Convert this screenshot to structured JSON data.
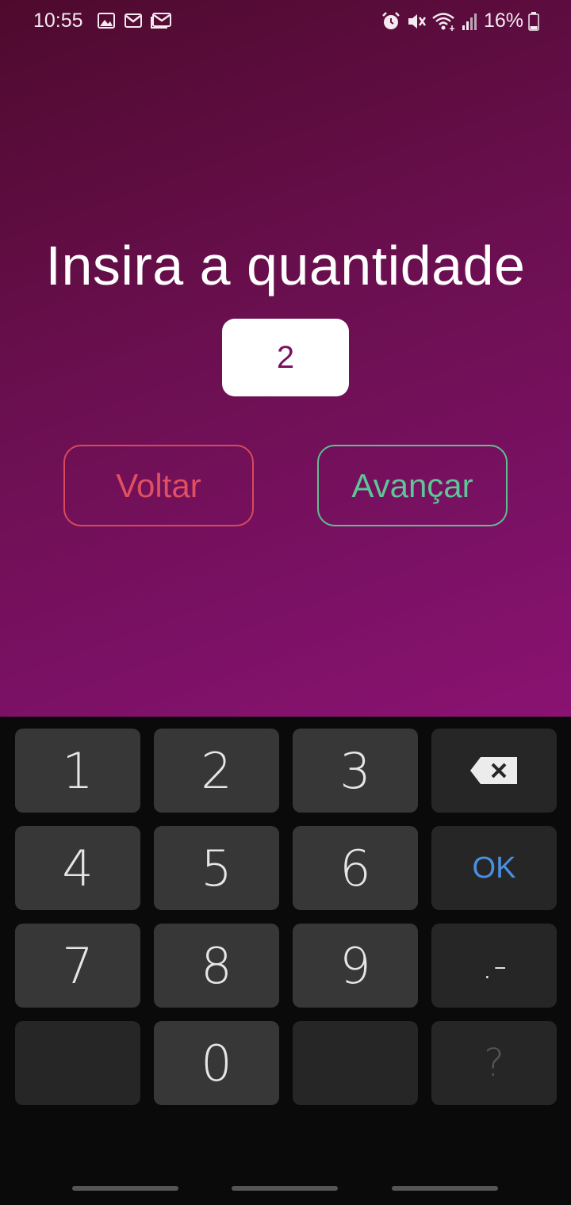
{
  "status_bar": {
    "time": "10:55",
    "battery": "16%",
    "notification_icons": [
      "image-icon",
      "gmail-icon",
      "gmail-icon"
    ],
    "system_icons": [
      "alarm-icon",
      "mute-icon",
      "wifi-icon",
      "signal-icon",
      "battery-icon"
    ]
  },
  "screen": {
    "title": "Insira a quantidade",
    "quantity_value": "2",
    "back_label": "Voltar",
    "next_label": "Avançar"
  },
  "colors": {
    "background_gradient": [
      "#4e0a2d",
      "#8a1272"
    ],
    "back_button": "#e05060",
    "next_button": "#5dc596",
    "ok_key": "#4a8fe0"
  },
  "keypad": {
    "keys": {
      "k1": "1",
      "k2": "2",
      "k3": "3",
      "k4": "4",
      "k5": "5",
      "k6": "6",
      "k7": "7",
      "k8": "8",
      "k9": "9",
      "k0": "0",
      "ok": "OK",
      "punct": ".-",
      "question": "?"
    }
  }
}
